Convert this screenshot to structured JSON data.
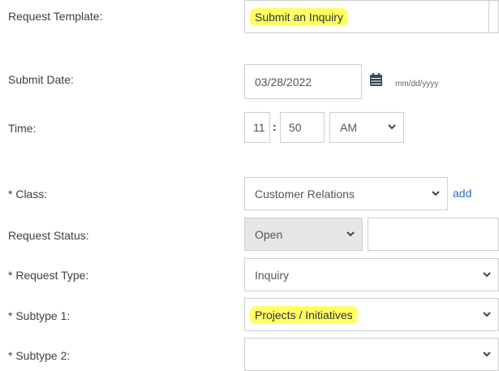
{
  "labels": {
    "request_template": "Request Template:",
    "submit_date": "Submit Date:",
    "time": "Time:",
    "class": "* Class:",
    "request_status": "Request Status:",
    "request_type": "* Request Type:",
    "subtype1": "* Subtype 1:",
    "subtype2": "* Subtype 2:"
  },
  "fields": {
    "request_template": "Submit an Inquiry",
    "submit_date": "03/28/2022",
    "date_format": "mm/dd/yyyy",
    "time_hour": "11",
    "time_separator": ":",
    "time_minute": "50",
    "time_ampm": "AM",
    "class": "Customer Relations",
    "class_add_link": "add",
    "request_status": "Open",
    "request_status_extra": "",
    "request_type": "Inquiry",
    "subtype1": "Projects / Initiatives",
    "subtype2": ""
  },
  "icons": {
    "calendar": "calendar-icon",
    "dropdown": "chevron-down-icon"
  },
  "colors": {
    "highlight": "#ffff66",
    "link": "#2a6db5",
    "calendar": "#3a4a5e",
    "disabled_bg": "#e6e6e6"
  }
}
